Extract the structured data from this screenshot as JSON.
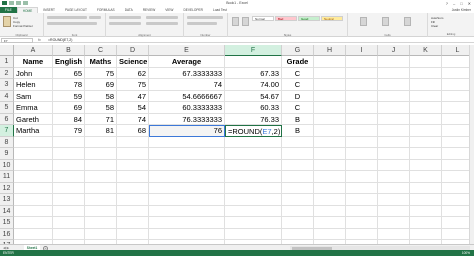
{
  "window": {
    "title": "Book1 - Excel",
    "sign_in": "Justin Kimber"
  },
  "ribbon": {
    "tabs": [
      "FILE",
      "HOME",
      "INSERT",
      "PAGE LAYOUT",
      "FORMULAS",
      "DATA",
      "REVIEW",
      "VIEW",
      "DEVELOPER",
      "Load Test"
    ],
    "cut": "Cut",
    "copy": "Copy",
    "format_painter": "Format Painter",
    "groups": {
      "clipboard": "Clipboard",
      "font": "Font",
      "alignment": "Alignment",
      "number": "Number",
      "styles": "Styles",
      "cells": "Cells",
      "editing": "Editing"
    },
    "styles": [
      "Normal",
      "Bad",
      "Good",
      "Neutral"
    ],
    "autosum": "AutoSum",
    "fill": "Fill",
    "clear": "Clear"
  },
  "formula_bar": {
    "name_box": "F7",
    "fx": "fx",
    "content": "=ROUND(E7,2)"
  },
  "grid": {
    "columns": [
      "A",
      "B",
      "C",
      "D",
      "E",
      "F",
      "G",
      "H",
      "I",
      "J",
      "K",
      "L"
    ],
    "rows": [
      "1",
      "2",
      "3",
      "4",
      "5",
      "6",
      "7",
      "8",
      "9",
      "10",
      "11",
      "12",
      "13",
      "14",
      "15",
      "16",
      "17"
    ],
    "headers": [
      "Name",
      "English",
      "Maths",
      "Science",
      "Average",
      "",
      "Grade"
    ],
    "data": [
      [
        "John",
        "65",
        "75",
        "62",
        "67.3333333",
        "67.33",
        "C"
      ],
      [
        "Helen",
        "78",
        "69",
        "75",
        "74",
        "74.00",
        "C"
      ],
      [
        "Sam",
        "59",
        "58",
        "47",
        "54.6666667",
        "54.67",
        "D"
      ],
      [
        "Emma",
        "69",
        "58",
        "54",
        "60.3333333",
        "60.33",
        "C"
      ],
      [
        "Gareth",
        "84",
        "71",
        "74",
        "76.3333333",
        "76.33",
        "B"
      ],
      [
        "Martha",
        "79",
        "81",
        "68",
        "76",
        "",
        "B"
      ]
    ],
    "editing": {
      "prefix": "=ROUND(",
      "ref": "E7",
      "suffix": ",2)"
    }
  },
  "sheet": {
    "tab": "Sheet1",
    "add": "+",
    "nav": "◀ ▶"
  },
  "status": {
    "mode": "ENTER",
    "zoom": "100%"
  },
  "colors": {
    "accent": "#217346",
    "ref": "#3c78d8"
  }
}
